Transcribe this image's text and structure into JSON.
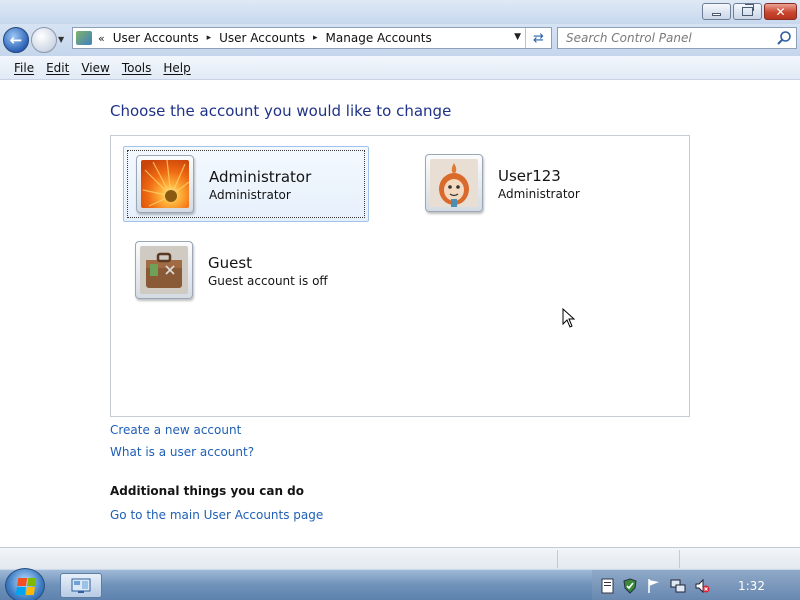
{
  "window": {
    "controls": {
      "minimize_icon": "minimize-icon",
      "maximize_icon": "restore-icon",
      "close_icon": "close-icon",
      "close_glyph": "✕"
    }
  },
  "address_bar": {
    "overflow": "«",
    "crumbs": [
      "User Accounts",
      "User Accounts",
      "Manage Accounts"
    ],
    "separator": "▸"
  },
  "search": {
    "placeholder": "Search Control Panel"
  },
  "menu": {
    "items": [
      "File",
      "Edit",
      "View",
      "Tools",
      "Help"
    ]
  },
  "main": {
    "heading": "Choose the account you would like to change",
    "accounts": [
      {
        "name": "Administrator",
        "role": "Administrator",
        "picture": "orange-flower-picture",
        "selected": true
      },
      {
        "name": "User123",
        "role": "Administrator",
        "picture": "cartoon-character-picture",
        "selected": false
      },
      {
        "name": "Guest",
        "role": "Guest account is off",
        "picture": "briefcase-picture",
        "selected": false
      }
    ],
    "links": {
      "create": "Create a new account",
      "what_is": "What is a user account?"
    },
    "additional": {
      "heading": "Additional things you can do",
      "link": "Go to the main User Accounts page"
    }
  },
  "taskbar": {
    "clock": "1:32"
  },
  "colors": {
    "heading": "#1e3287",
    "link": "#1f5fb6",
    "selection": "#e6f0fb"
  }
}
